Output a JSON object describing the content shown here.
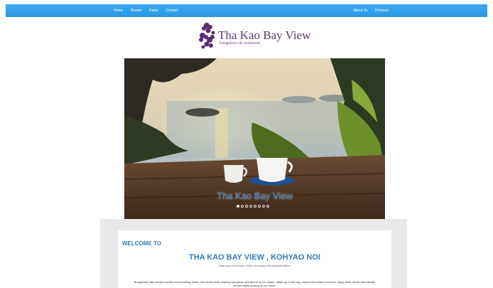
{
  "nav": {
    "left": [
      "Home",
      "Rooms",
      "Rates",
      "Contact"
    ],
    "right": [
      "About Us",
      "Reviews"
    ]
  },
  "logo": {
    "title": "Tha Kao Bay View",
    "subtitle": "bungalows & restaurant"
  },
  "carousel": {
    "caption": "Tha Kao Bay View",
    "slide_count": 8,
    "active_index": 0
  },
  "welcome": {
    "label": "WELCOME TO",
    "title": "THA KAO BAY VIEW , KOHYAO NOI",
    "tagline": "Stay near the beach, relax, and enjoy the peaceful island",
    "body": "Bungalows offer simple comfort and stunning views, one of the most relaxing bungalow operations on the island. Wake up to the bay, explore mountains and sea, enjoy fresh meals and friendly service while staying at our resort."
  },
  "colors": {
    "nav": "#2d98e2",
    "accent": "#2f7cbd",
    "logo": "#5a3a6e"
  }
}
